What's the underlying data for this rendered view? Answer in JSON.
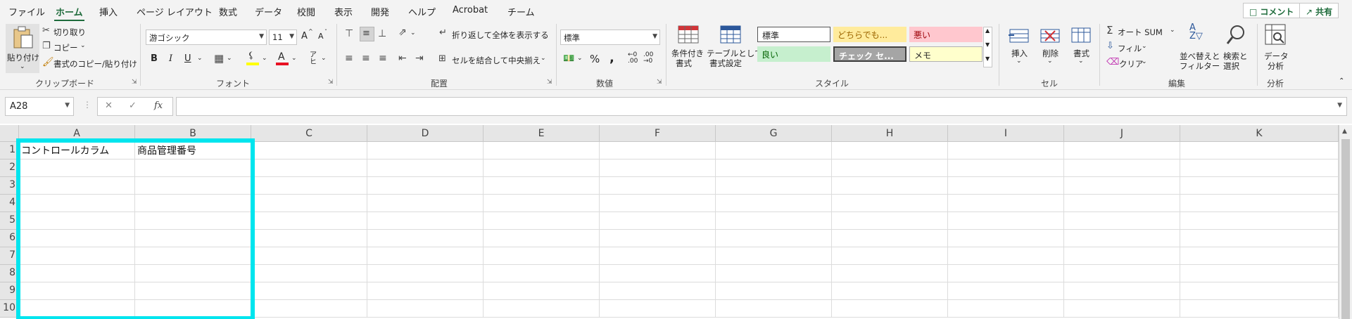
{
  "tabs": [
    "ファイル",
    "ホーム",
    "挿入",
    "ページ レイアウト",
    "数式",
    "データ",
    "校閲",
    "表示",
    "開発",
    "ヘルプ",
    "Acrobat",
    "チーム"
  ],
  "comment_label": "コメント",
  "share_label": "共有",
  "clipboard": {
    "paste": "貼り付け",
    "cut": "切り取り",
    "copy": "コピー",
    "format_painter": "書式のコピー/貼り付け",
    "label": "クリップボード"
  },
  "font": {
    "name": "游ゴシック",
    "size": "11",
    "bold": "B",
    "italic": "I",
    "underline": "U",
    "grow": "A",
    "shrink": "A",
    "highlight_color": "#ffff00",
    "font_color": "#e81123",
    "label": "フォント"
  },
  "alignment": {
    "wrap": "折り返して全体を表示する",
    "merge": "セルを結合して中央揃え",
    "label": "配置"
  },
  "number": {
    "format": "標準",
    "percent": "%",
    "comma": ",",
    "label": "数値"
  },
  "styles": {
    "conditional": [
      "条件付き",
      "書式"
    ],
    "table": [
      "テーブルとして",
      "書式設定"
    ],
    "cells": [
      {
        "label": "標準",
        "bg": "#ffffff",
        "fg": "#262626"
      },
      {
        "label": "どちらでも...",
        "bg": "#ffeb9c",
        "fg": "#9c6500"
      },
      {
        "label": "悪い",
        "bg": "#ffc7ce",
        "fg": "#9c0006"
      },
      {
        "label": "良い",
        "bg": "#c6efce",
        "fg": "#006100"
      },
      {
        "label": "チェック セ...",
        "bg": "#a5a5a5",
        "fg": "#ffffff"
      },
      {
        "label": "メモ",
        "bg": "#ffffcc",
        "fg": "#262626"
      }
    ],
    "label": "スタイル"
  },
  "cells_group": {
    "insert": "挿入",
    "delete": "削除",
    "format": "書式",
    "label": "セル"
  },
  "editing": {
    "autosum": "オート SUM",
    "fill": "フィル",
    "clear": "クリア",
    "sort": [
      "並べ替えと",
      "フィルター"
    ],
    "find": [
      "検索と",
      "選択"
    ],
    "label": "編集"
  },
  "analysis": {
    "data_analysis": [
      "データ",
      "分析"
    ],
    "label": "分析"
  },
  "formula_bar": {
    "name_box": "A28",
    "fx": "fx",
    "value": ""
  },
  "columns": [
    "A",
    "B",
    "C",
    "D",
    "E",
    "F",
    "G",
    "H",
    "I",
    "J",
    "K"
  ],
  "rows": [
    "1",
    "2",
    "3",
    "4",
    "5",
    "6",
    "7",
    "8",
    "9",
    "10"
  ],
  "cells": {
    "A1": "コントロールカラム",
    "B1": "商品管理番号"
  },
  "colors": {
    "accent": "#1e6b3b",
    "highlight_border": "#00e5ee"
  }
}
